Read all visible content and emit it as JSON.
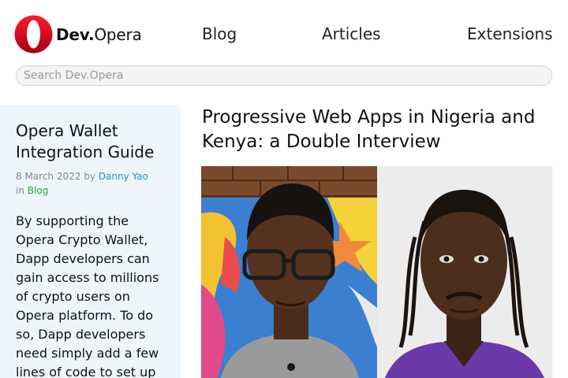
{
  "header": {
    "logo_bold": "Dev.",
    "logo_regular": "Opera",
    "nav": [
      {
        "label": "Blog"
      },
      {
        "label": "Articles"
      },
      {
        "label": "Extensions"
      }
    ]
  },
  "search": {
    "placeholder": "Search Dev.Opera",
    "value": ""
  },
  "sidebar": {
    "title": "Opera Wallet Integration Guide",
    "date": "8 March 2022",
    "by": "by",
    "author": "Danny Yao",
    "in": "in",
    "category": "Blog",
    "excerpt": "By supporting the Opera Crypto Wallet, Dapp developers can gain access to millions of crypto users on Opera platform. To do so, Dapp developers need simply add a few lines of code to set up"
  },
  "article": {
    "title": "Progressive Web Apps in Nigeria and Kenya: a Double Interview"
  },
  "colors": {
    "brand_red": "#e3152b",
    "link_blue": "#2a8fc7",
    "link_green": "#2e9e3e",
    "sidebar_bg": "#eef6fb"
  }
}
